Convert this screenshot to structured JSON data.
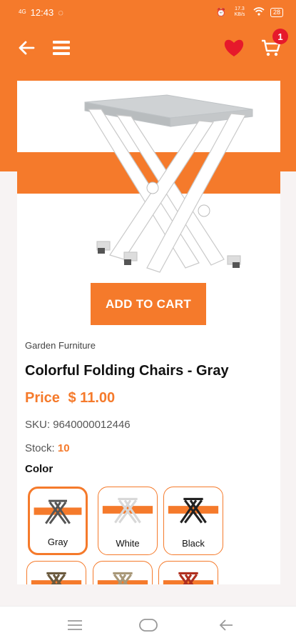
{
  "status_bar": {
    "signal": "4G",
    "time": "12:43",
    "speed": "17.3 KB/s",
    "battery": "28"
  },
  "app_bar": {
    "cart_count": "1"
  },
  "product": {
    "category": "Garden Furniture",
    "title": "Colorful Folding Chairs - Gray",
    "price_label": "Price",
    "price_value": "$ 11.00",
    "sku_label": "SKU:",
    "sku_value": "9640000012446",
    "stock_label": "Stock:",
    "stock_value": "10",
    "color_label": "Color",
    "add_to_cart": "ADD TO CART"
  },
  "colors": [
    {
      "name": "Gray",
      "selected": true,
      "chair": "#555555"
    },
    {
      "name": "White",
      "selected": false,
      "chair": "#d8d8d8"
    },
    {
      "name": "Black",
      "selected": false,
      "chair": "#222222"
    },
    {
      "name": "",
      "selected": false,
      "chair": "#6b5a3e"
    },
    {
      "name": "",
      "selected": false,
      "chair": "#a89878"
    },
    {
      "name": "",
      "selected": false,
      "chair": "#b03020"
    }
  ],
  "theme": {
    "accent": "#f57a2b",
    "badge": "#e6192b",
    "heart": "#e6192b"
  }
}
